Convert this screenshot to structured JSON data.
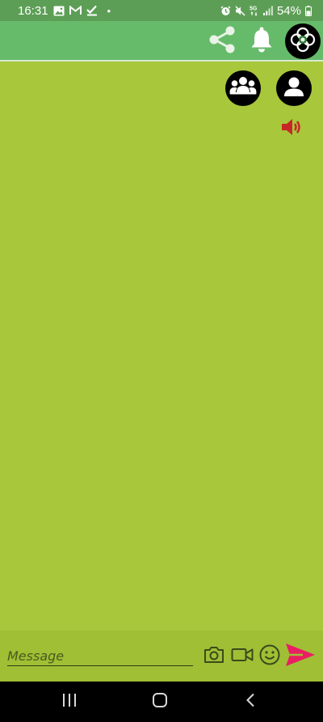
{
  "status_bar": {
    "time": "16:31",
    "dot": "•",
    "battery": "54%",
    "left_icons": [
      "gallery-icon",
      "gmail-icon",
      "check-icon"
    ],
    "right_icons": [
      "alarm-icon",
      "mute-icon",
      "5g-icon",
      "signal-icon",
      "battery-icon"
    ]
  },
  "app_bar": {
    "icons": [
      "share-icon",
      "bell-icon",
      "clover-logo-icon"
    ]
  },
  "chat": {
    "buttons": [
      "group-icon",
      "person-icon",
      "speaker-icon"
    ]
  },
  "composer": {
    "placeholder": "Message",
    "icons": [
      "camera-icon",
      "video-icon",
      "emoji-icon",
      "send-icon"
    ]
  },
  "colors": {
    "status_bar": "#5d9e56",
    "app_bar": "#66bb6a",
    "chat_background": "#a8c73b",
    "composer_background": "#a0bf35",
    "speaker": "#c62828",
    "send": "#e91e63"
  },
  "nav_bar": {
    "icons": [
      "recent-apps-icon",
      "home-icon",
      "back-icon"
    ]
  }
}
